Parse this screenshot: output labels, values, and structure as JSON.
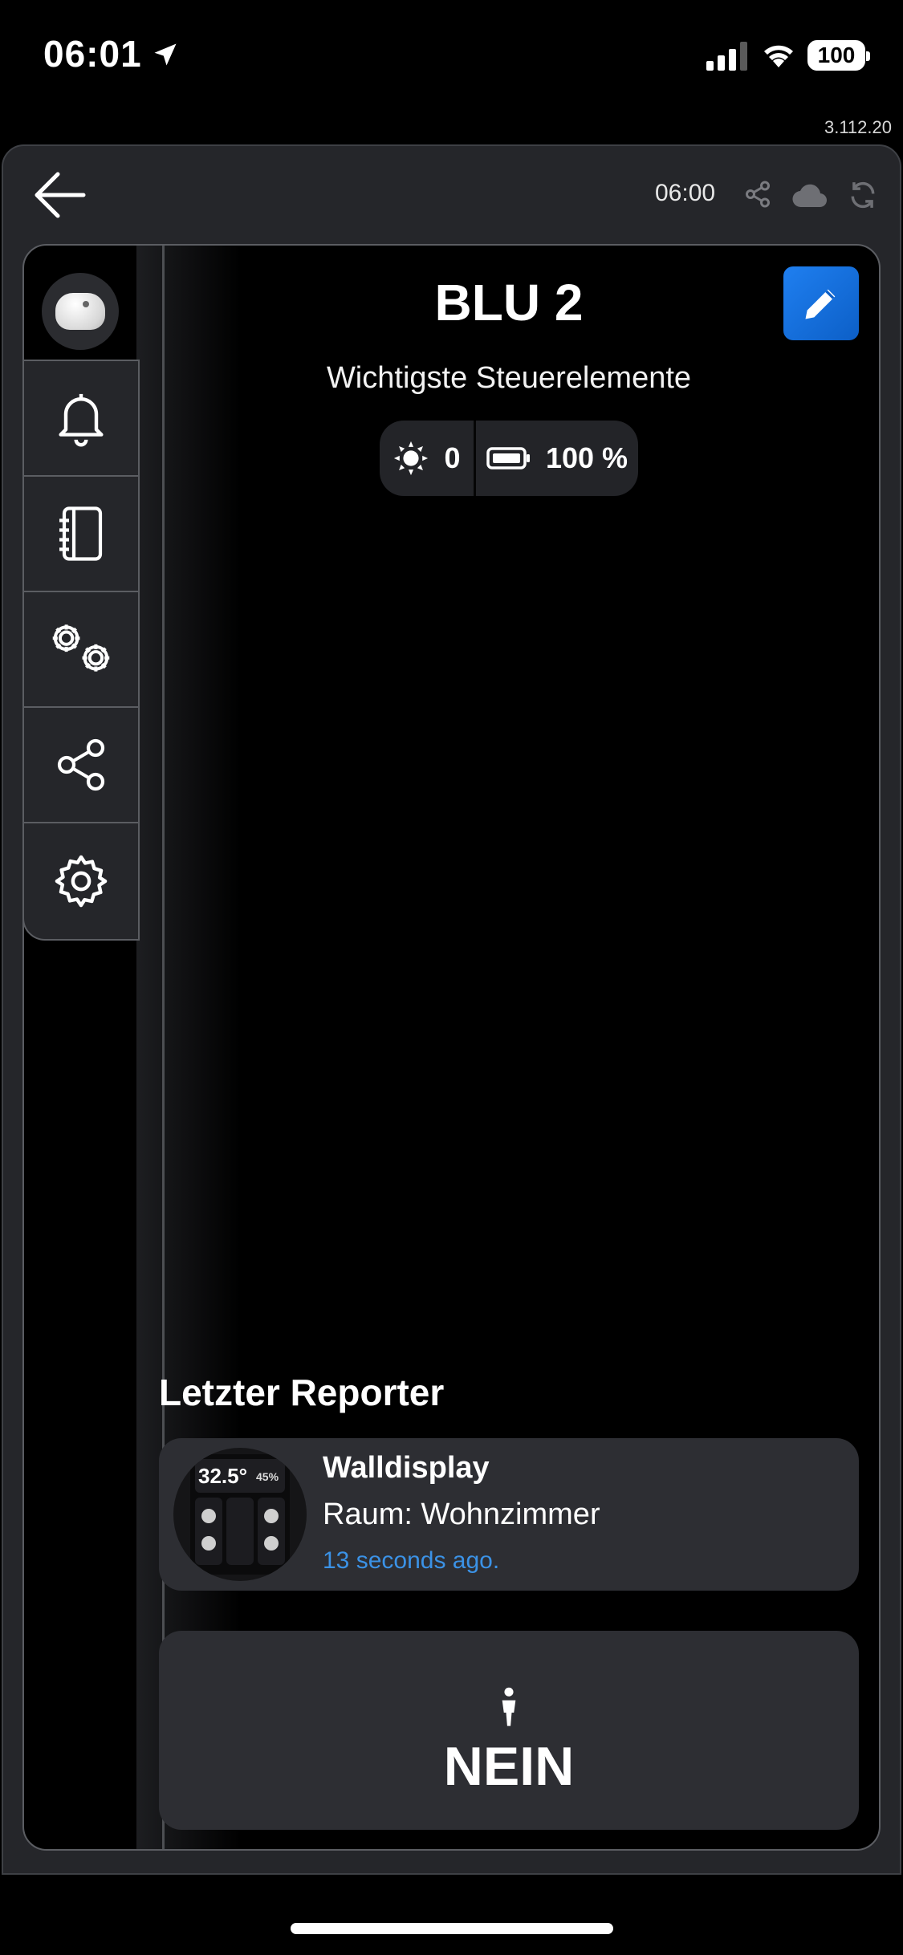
{
  "status_bar": {
    "time": "06:01",
    "battery": "100"
  },
  "app": {
    "version": "3.112.20"
  },
  "topbar": {
    "time": "06:00"
  },
  "device": {
    "title": "BLU 2",
    "subtitle": "Wichtigste Steuerelemente",
    "illuminance": "0",
    "battery": "100 %"
  },
  "sidebar": {
    "items": [
      {
        "icon": "bell-icon"
      },
      {
        "icon": "notebook-icon"
      },
      {
        "icon": "gears-icon"
      },
      {
        "icon": "share-icon"
      },
      {
        "icon": "gear-icon"
      }
    ]
  },
  "last_reporter": {
    "heading": "Letzter Reporter",
    "name": "Walldisplay",
    "room": "Raum: Wohnzimmer",
    "time_ago": "13 seconds ago.",
    "thumb": {
      "temp": "32.5°",
      "humidity": "45%"
    }
  },
  "status": {
    "label": "NEIN"
  },
  "colors": {
    "accent": "#1f7ff0",
    "link": "#3b92e6",
    "panel": "#25262a",
    "card": "#2d2e33"
  }
}
